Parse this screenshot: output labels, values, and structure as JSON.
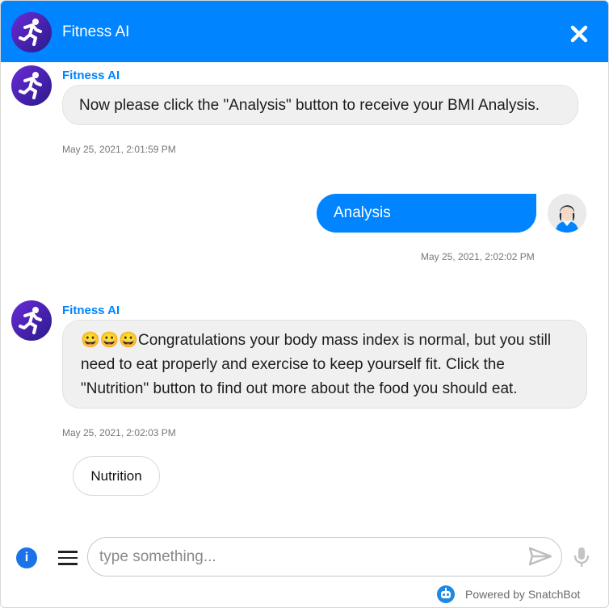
{
  "header": {
    "title": "Fitness AI",
    "close_icon": "close-icon"
  },
  "colors": {
    "brand": "#0084ff",
    "bot_avatar": "#4a1fb8",
    "bot_name": "#0084ff",
    "bubble_bot": "#f1f0f0"
  },
  "messages": [
    {
      "sender": "Fitness AI",
      "text": "Now please click the \"Analysis\" button to receive your BMI Analysis.",
      "timestamp": "May 25, 2021, 2:01:59 PM"
    },
    {
      "sender": "user",
      "text": "Analysis",
      "timestamp": "May 25, 2021, 2:02:02 PM"
    },
    {
      "sender": "Fitness AI",
      "emoji": "😀😀😀",
      "text": "Congratulations your body mass index is normal, but you still need to eat properly and exercise to keep yourself fit. Click the \"Nutrition\" button to find out more about the food you should eat.",
      "timestamp": "May 25, 2021, 2:02:03 PM"
    }
  ],
  "quick_replies": [
    "Nutrition"
  ],
  "composer": {
    "placeholder": "type something...",
    "info_glyph": "i",
    "info_icon": "info-icon",
    "menu_icon": "menu-icon",
    "send_icon": "send-icon",
    "mic_icon": "microphone-icon"
  },
  "footer": {
    "powered_by": "Powered by SnatchBot"
  }
}
